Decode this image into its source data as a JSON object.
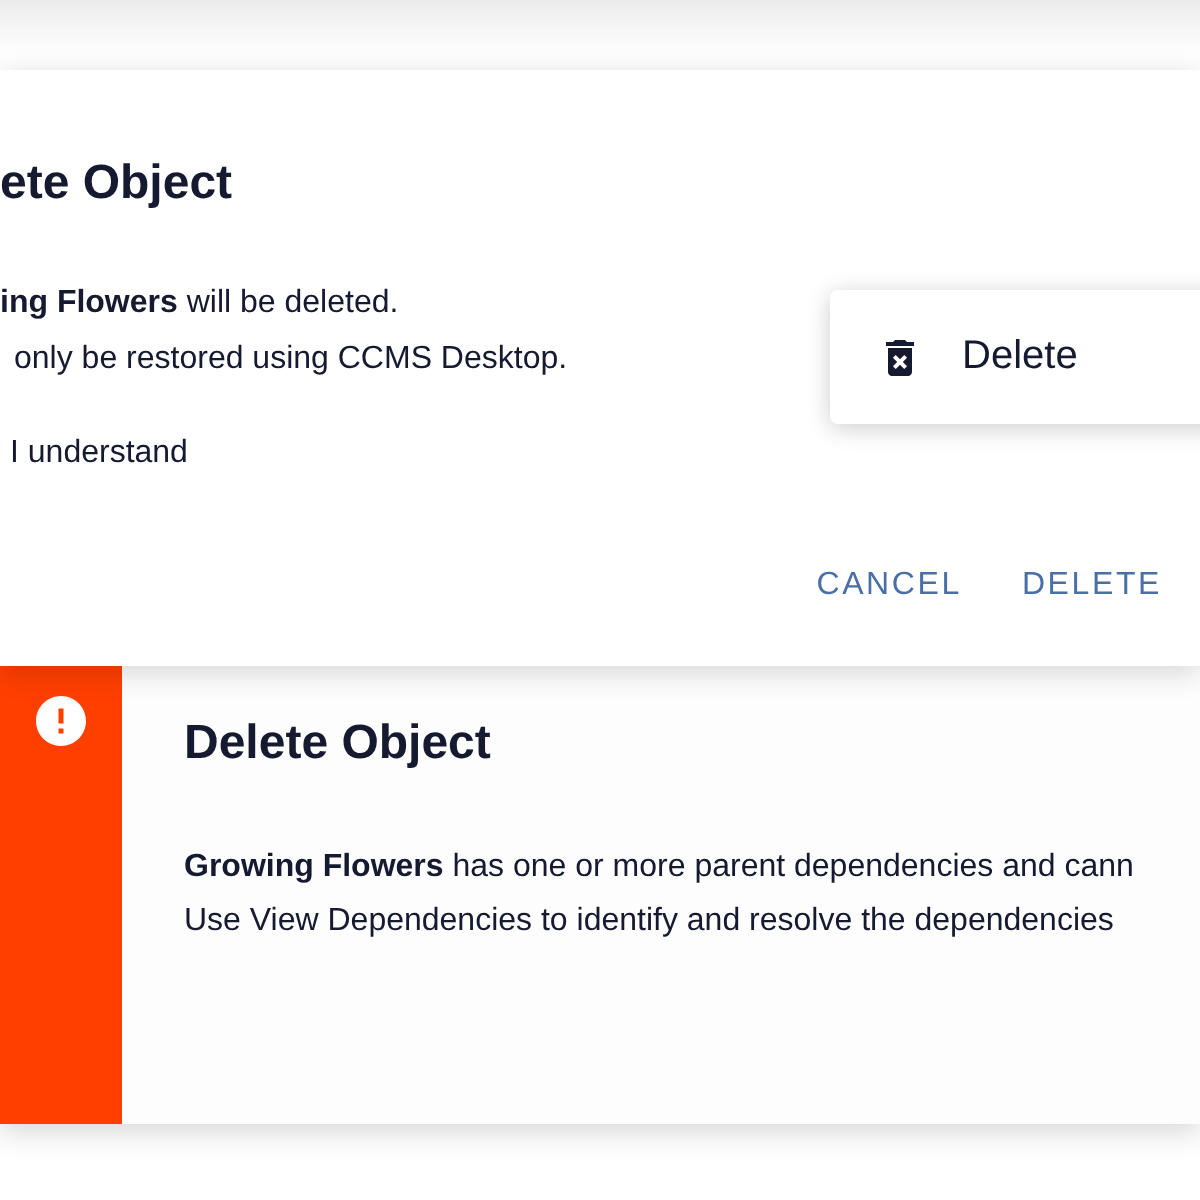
{
  "dialog": {
    "title": "ete Object",
    "message": [
      "**ing Flowers** will be deleted.",
      "only be restored using CCMS Desktop."
    ],
    "confirm_label": "I understand",
    "buttons": [
      {
        "label": "CANCEL"
      },
      {
        "label": "DELETE"
      }
    ]
  },
  "context_menu": {
    "items": [
      {
        "label": "Delete"
      }
    ]
  },
  "alert": {
    "title": "Delete Object",
    "message": [
      "**Growing Flowers** has one or more parent dependencies and cann",
      "Use View Dependencies to identify and resolve the dependencies"
    ]
  }
}
